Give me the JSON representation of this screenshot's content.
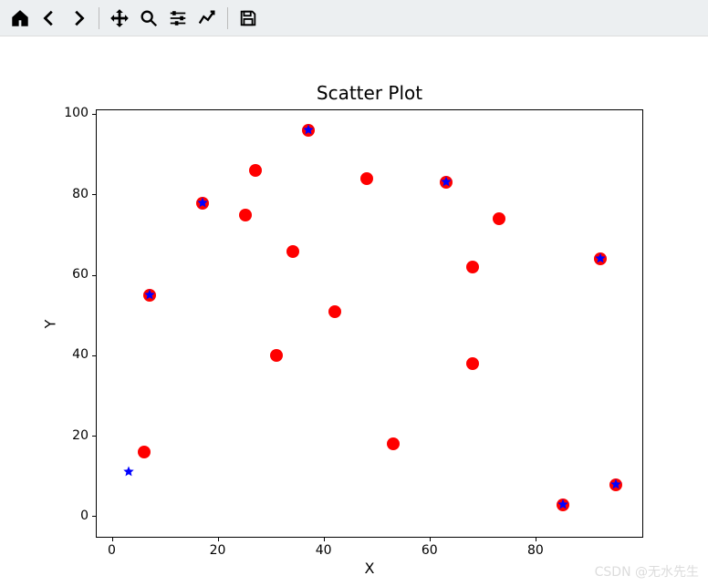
{
  "toolbar": {
    "home": {
      "name": "home-icon"
    },
    "back": {
      "name": "back-icon"
    },
    "forward": {
      "name": "forward-icon"
    },
    "pan": {
      "name": "move-icon"
    },
    "zoom": {
      "name": "zoom-icon"
    },
    "config": {
      "name": "sliders-icon"
    },
    "edit": {
      "name": "axes-edit-icon"
    },
    "save": {
      "name": "save-icon"
    }
  },
  "chart_data": {
    "type": "scatter",
    "title": "Scatter Plot",
    "xlabel": "X",
    "ylabel": "Y",
    "xlim": [
      -3,
      100
    ],
    "ylim": [
      -5,
      101
    ],
    "xticks": [
      0,
      20,
      40,
      60,
      80
    ],
    "yticks": [
      0,
      20,
      40,
      60,
      80,
      100
    ],
    "series": [
      {
        "name": "red-circles",
        "marker": "circle",
        "color": "#fe0000",
        "size": 14,
        "points": [
          [
            6,
            16
          ],
          [
            7,
            55
          ],
          [
            17,
            78
          ],
          [
            25,
            75
          ],
          [
            27,
            86
          ],
          [
            31,
            40
          ],
          [
            34,
            66
          ],
          [
            37,
            96
          ],
          [
            42,
            51
          ],
          [
            48,
            84
          ],
          [
            53,
            18
          ],
          [
            63,
            83
          ],
          [
            68,
            62
          ],
          [
            68,
            38
          ],
          [
            73,
            74
          ],
          [
            85,
            3
          ],
          [
            92,
            64
          ],
          [
            95,
            8
          ]
        ]
      },
      {
        "name": "blue-stars",
        "marker": "star",
        "color": "#0000ff",
        "size": 12,
        "points": [
          [
            3,
            11
          ],
          [
            7,
            55
          ],
          [
            17,
            78
          ],
          [
            37,
            96
          ],
          [
            63,
            83
          ],
          [
            85,
            3
          ],
          [
            92,
            64
          ],
          [
            95,
            8
          ]
        ]
      }
    ]
  },
  "watermark": "CSDN @无水先生"
}
